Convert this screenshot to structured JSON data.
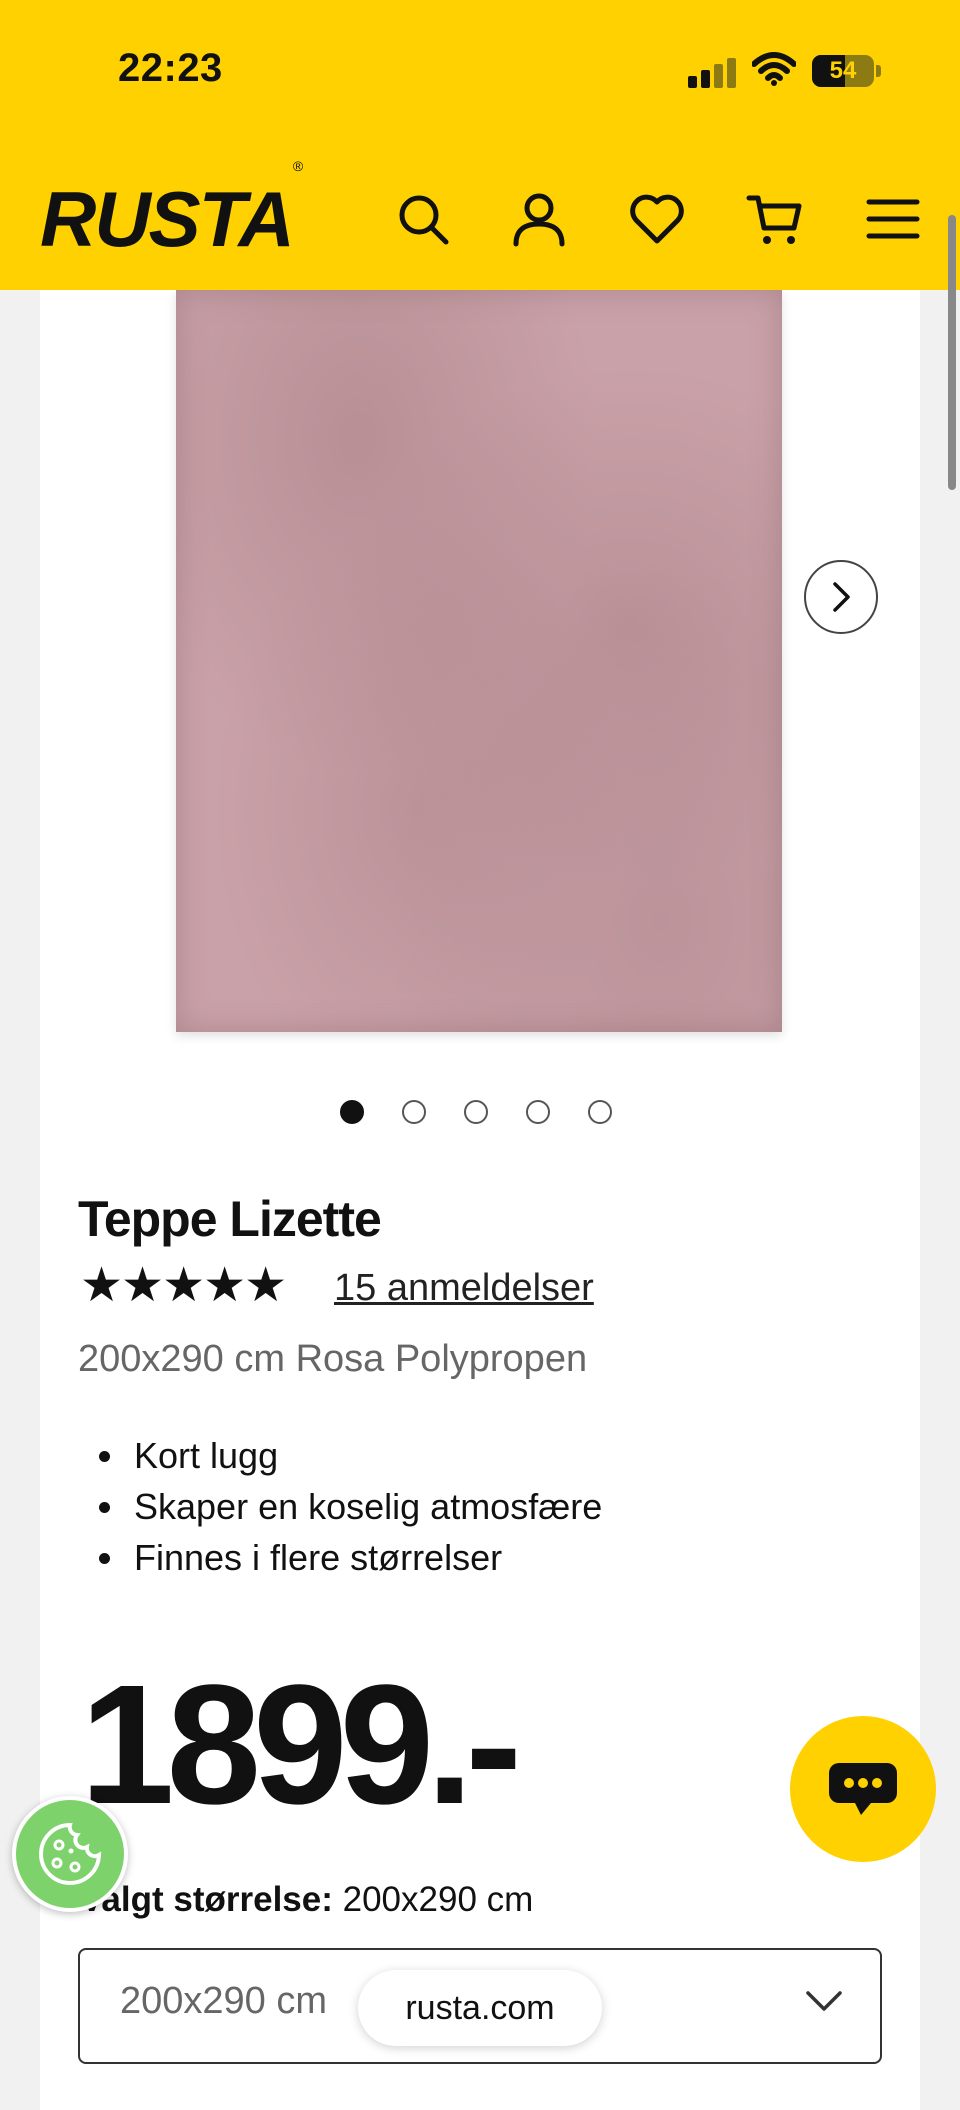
{
  "status_bar": {
    "time": "22:23",
    "battery": "54",
    "battery_level": 0.54,
    "signal_icon": "signal-bars-icon",
    "wifi_icon": "wifi-icon"
  },
  "header": {
    "logo": "RUSTA",
    "logo_mark": "®",
    "icons": [
      "search-icon",
      "account-icon",
      "heart-icon",
      "cart-icon",
      "menu-icon"
    ],
    "brand_color": "#FFD100"
  },
  "gallery": {
    "image_alt": "Rosa teppe",
    "total_images": 5,
    "active_index": 0,
    "next_icon": "chevron-right-icon"
  },
  "product": {
    "title": "Teppe Lizette",
    "stars": "★★★★★",
    "rating": 5,
    "reviews_link": "15 anmeldelser",
    "subtitle": "200x290 cm Rosa Polypropen",
    "features": [
      "Kort lugg",
      "Skaper en koselig atmosfære",
      "Finnes i flere størrelser"
    ],
    "price": "1899.-"
  },
  "size_selector": {
    "label": "Valgt størrelse:",
    "selected_value": "200x290 cm",
    "dropdown_value": "200x290 cm",
    "chevron_icon": "chevron-down-icon"
  },
  "floating": {
    "chat_icon": "chat-bubble-icon",
    "cookie_icon": "cookie-icon",
    "url": "rusta.com"
  }
}
